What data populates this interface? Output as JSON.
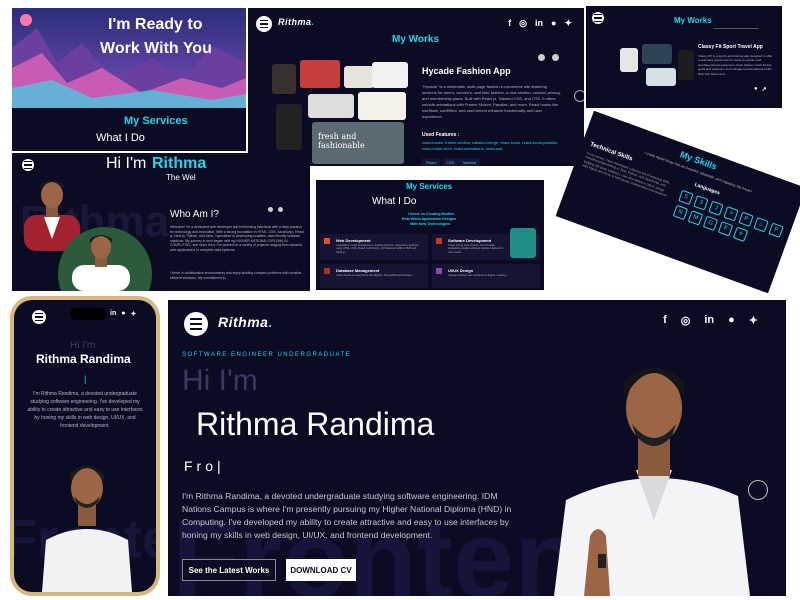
{
  "colors": {
    "accent": "#23d5e8",
    "panel_bg": "#0c0b24",
    "white": "#ffffff"
  },
  "p1": {
    "title_line1": "I'm Ready to",
    "title_line2": "Work With You",
    "services_title": "My Services",
    "what_i_do": "What I Do"
  },
  "p2": {
    "brand": "Rithma",
    "heading": "My Works",
    "project_title": "Hycade Fashion App",
    "project_desc": "\"Hycade\" is a minimalist, multi-page fashion e-commerce site featuring sections for men's, women's, and kids' fashion, a new section, contact, pricing, and membership plans. Built with React js, Tailwind CSS, and CSS, it offers smooth animations with Framer Motion, Parallax, and more. React hooks like useState, useEffect, and useContext enhance functionality and user experience.",
    "used_features_label": "Used Features :",
    "features": "react-hooks, framer-motion, tailwind-merge, react-icons, react-scroll-parallax, react-router-dom, react-animations, react-css...",
    "tags": [
      "React",
      "CSS",
      "Tailwind"
    ],
    "thumb_text": "fresh and fashionable"
  },
  "p3": {
    "heading": "My Works",
    "project_title": "Classy Fit Sport Travel App",
    "project_desc": "Classy FIT is a sports and training app designed to offer a seamless experience for users to explore and purchase fitness equipment, book classes, track fitness goals and workouts, and manage a personalised profile. Built with React and..."
  },
  "p4": {
    "greeting": "Hi I'm",
    "name": "Rithma",
    "subtitle": "The Wel",
    "who_title": "Who Am I?",
    "who_para1": "Welcome! I'm a dedicated web developer and freelancing individual with a deep passion for technology and innovation. With a strong foundation in HTML, CSS, JavaScript, React js, Next js, Python, and Java, I specialize in developing scalable, user-friendly software solutions. My journey in tech began with my HIGHER NATIONAL DIPLOMA IN COMPUTING, and since then, I've worked on a variety of projects ranging from dynamic web applications to complete data systems.",
    "who_para2": "I thrive in collaborative environments and enjoy tackling complex problems with creative, efficient solutions. My commitment to...",
    "watermark": "Rithma"
  },
  "p5": {
    "heading": "My Services",
    "subheading": "What I Do",
    "tagline_1": "I focus on Creating Modern",
    "tagline_2": "Real World Application Designs",
    "tagline_3": "With New Technologies",
    "services": [
      {
        "title": "Web Development",
        "desc": "I specialize in web development, creating dynamic, responsive websites using HTML, CSS, React, and Next.js, with backend skills in PHP and Node.js."
      },
      {
        "title": "Software Development",
        "desc": "I have strong Java, Python, and C# skills, developing reliable software solutions tailored to user needs."
      },
      {
        "title": "Database Management",
        "desc": "I have hands-on experience with MySQL, MongoDB and Firebase..."
      },
      {
        "title": "UI/UX Design",
        "desc": "I design intuitive user interfaces in Figma, creating..."
      }
    ]
  },
  "p6": {
    "heading": "My Skills",
    "subheading": "I create digital things that are beautiful, adaptable, and engaging. My Areas?",
    "tech_title": "Technical Skills",
    "tech_desc": "In my career, I have developed a diverse set of technical skills, including programming in Java, Python, and JavaScript, and building full-stack solutions. I am also skilled in UI/UX design with Figma and thrive in fast-paced, collaborative environments.",
    "languages_title": "Languages"
  },
  "p7": {
    "greeting": "Hi I'm",
    "name": "Rithma Randima",
    "typing": "|",
    "about": "I'm Rithma Randima, a devoted undergraduate studying software engineering. I've developed my ability to create attractive and easy to use interfaces by honing my skills in web design, UI/UX, and frontend development.",
    "watermark": "Frontend"
  },
  "p8": {
    "brand": "Rithma",
    "role": "SOFTWARE ENGINEER UNDERGRADUATE",
    "greeting": "Hi I'm",
    "name": "Rithma Randima",
    "typing": "Fro|",
    "about": "I'm Rithma Randima, a devoted undergraduate studying software engineering. IDM Nations Campus is where I'm presently pursuing my Higher National Diploma (HND) in Computing. I've developed my ability to create attractive and easy to use interfaces by honing my skills in web design, UI/UX, and frontend development.",
    "btn_works": "See the Latest Works",
    "btn_cv": "DOWNLOAD CV",
    "watermark": "Frontend"
  },
  "social_icons": [
    "facebook-icon",
    "instagram-icon",
    "linkedin-icon",
    "github-icon",
    "twitter-icon"
  ]
}
